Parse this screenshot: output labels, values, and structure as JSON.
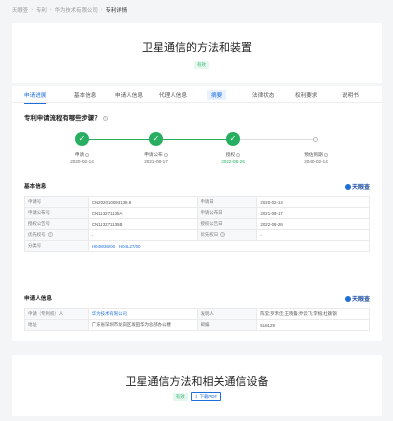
{
  "breadcrumb": [
    "天眼查",
    "专利",
    "华为技术有限公司",
    "专利详情"
  ],
  "header": {
    "title": "卫星通信的方法和装置",
    "status": "有效"
  },
  "tabs": [
    "申请进展",
    "基本信息",
    "申请人信息",
    "代理人信息",
    "摘要",
    "法律状态",
    "权利要求",
    "说明书"
  ],
  "progress": {
    "question": "专利申请流程有哪些步骤？",
    "steps": [
      {
        "label": "申请",
        "date": "2020-02-14",
        "done": true
      },
      {
        "label": "申请公布",
        "date": "2021-08-17",
        "done": true
      },
      {
        "label": "授权",
        "date": "2022-08-26",
        "done": true
      },
      {
        "label": "预估到期",
        "date": "2040-02-14",
        "done": false
      }
    ]
  },
  "basic": {
    "title": "基本信息",
    "brand": "天眼查",
    "rows": [
      [
        "申请号",
        "CN202010093138.6",
        "申请日",
        "2020-02-14"
      ],
      [
        "申请公布号",
        "CN113271135A",
        "申请公布日",
        "2021-08-17"
      ],
      [
        "授权公告号",
        "CN113271135B",
        "授权公告日",
        "2022-08-26"
      ],
      [
        "优先权号",
        "-",
        "优先权日",
        "-"
      ]
    ],
    "classification_label": "分类号",
    "classifications": [
      "H04W36/00",
      "H04L27/00"
    ]
  },
  "applicant": {
    "title": "申请人信息",
    "brand": "天眼查",
    "rows": [
      [
        "申请（专利权）人",
        "华为技术有限公司",
        "发明人",
        "陈莹;罗禾佳;王晓鲁;乔云飞;李榕;杜颖钢"
      ],
      [
        "地址",
        "广东省深圳市龙岗区坂田华为总部办公楼",
        "邮编",
        "518129"
      ]
    ]
  },
  "next": {
    "title": "卫星通信方法和相关通信设备",
    "status": "有效",
    "pdf_label": "下载PDF"
  }
}
